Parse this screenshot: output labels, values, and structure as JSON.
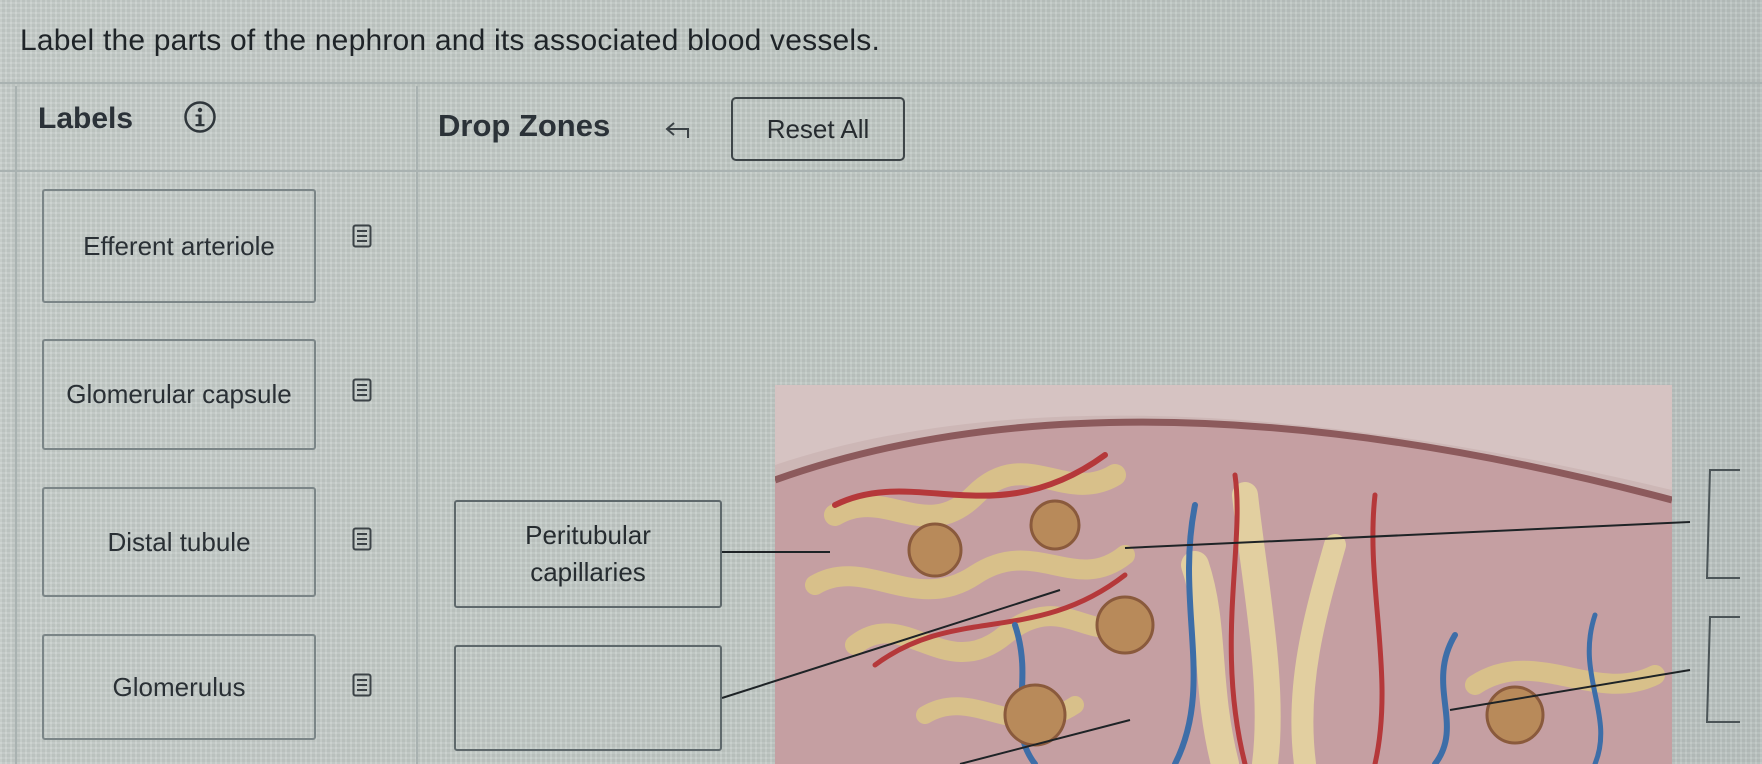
{
  "question": {
    "instruction": "Label the parts of the nephron and its associated blood vessels."
  },
  "labels_panel": {
    "heading": "Labels",
    "info_icon": "info-circle-icon",
    "items": [
      {
        "label": "Efferent arteriole",
        "icon": "document-icon"
      },
      {
        "label": "Glomerular capsule",
        "icon": "document-icon"
      },
      {
        "label": "Distal tubule",
        "icon": "document-icon"
      },
      {
        "label": "Glomerulus",
        "icon": "document-icon"
      }
    ]
  },
  "drop_zones_panel": {
    "heading": "Drop Zones",
    "undo_icon": "undo-arrow-icon",
    "reset_label": "Reset All",
    "zones": [
      {
        "text": "Peritubular\ncapillaries",
        "filled": true
      },
      {
        "text": "",
        "filled": false
      }
    ]
  },
  "colors": {
    "panel_background": "#c3cbc8",
    "tissue": "#c9a7a8",
    "tissue_border": "#8c5a5c",
    "tubule": "#d8c08a",
    "arteries": "#b5383a",
    "veins": "#3d6ea8"
  }
}
